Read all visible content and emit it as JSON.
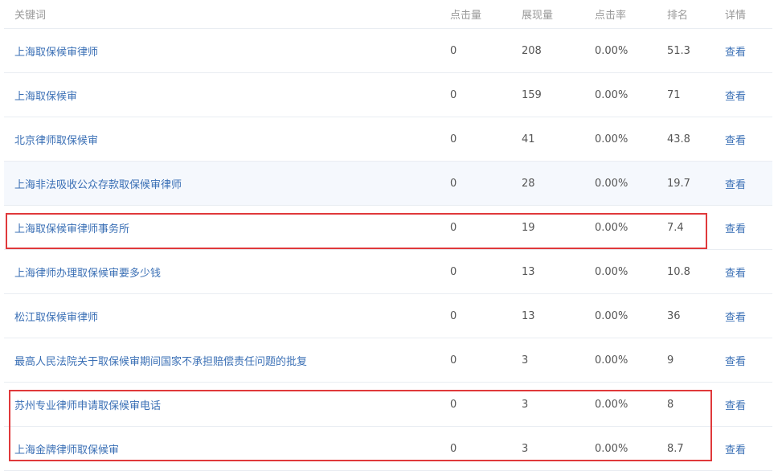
{
  "header": {
    "keyword": "关键词",
    "clicks": "点击量",
    "impressions": "展现量",
    "ctr": "点击率",
    "rank": "排名",
    "detail": "详情"
  },
  "rows": [
    {
      "keyword": "上海取保候审律师",
      "clicks": "0",
      "impressions": "208",
      "ctr": "0.00%",
      "rank": "51.3",
      "detail": "查看"
    },
    {
      "keyword": "上海取保候审",
      "clicks": "0",
      "impressions": "159",
      "ctr": "0.00%",
      "rank": "71",
      "detail": "查看"
    },
    {
      "keyword": "北京律师取保候审",
      "clicks": "0",
      "impressions": "41",
      "ctr": "0.00%",
      "rank": "43.8",
      "detail": "查看"
    },
    {
      "keyword": "上海非法吸收公众存款取保候审律师",
      "clicks": "0",
      "impressions": "28",
      "ctr": "0.00%",
      "rank": "19.7",
      "detail": "查看"
    },
    {
      "keyword": "上海取保候审律师事务所",
      "clicks": "0",
      "impressions": "19",
      "ctr": "0.00%",
      "rank": "7.4",
      "detail": "查看"
    },
    {
      "keyword": "上海律师办理取保候审要多少钱",
      "clicks": "0",
      "impressions": "13",
      "ctr": "0.00%",
      "rank": "10.8",
      "detail": "查看"
    },
    {
      "keyword": "松江取保候审律师",
      "clicks": "0",
      "impressions": "13",
      "ctr": "0.00%",
      "rank": "36",
      "detail": "查看"
    },
    {
      "keyword": "最高人民法院关于取保候审期间国家不承担赔偿责任问题的批复",
      "clicks": "0",
      "impressions": "3",
      "ctr": "0.00%",
      "rank": "9",
      "detail": "查看"
    },
    {
      "keyword": "苏州专业律师申请取保候审电话",
      "clicks": "0",
      "impressions": "3",
      "ctr": "0.00%",
      "rank": "8",
      "detail": "查看"
    },
    {
      "keyword": "上海金牌律师取保候审",
      "clicks": "0",
      "impressions": "3",
      "ctr": "0.00%",
      "rank": "8.7",
      "detail": "查看"
    }
  ],
  "colors": {
    "link": "#3a6fb5",
    "header_text": "#999999",
    "hover_row": "#f5f8fd",
    "annotation_box": "#e0393b"
  }
}
